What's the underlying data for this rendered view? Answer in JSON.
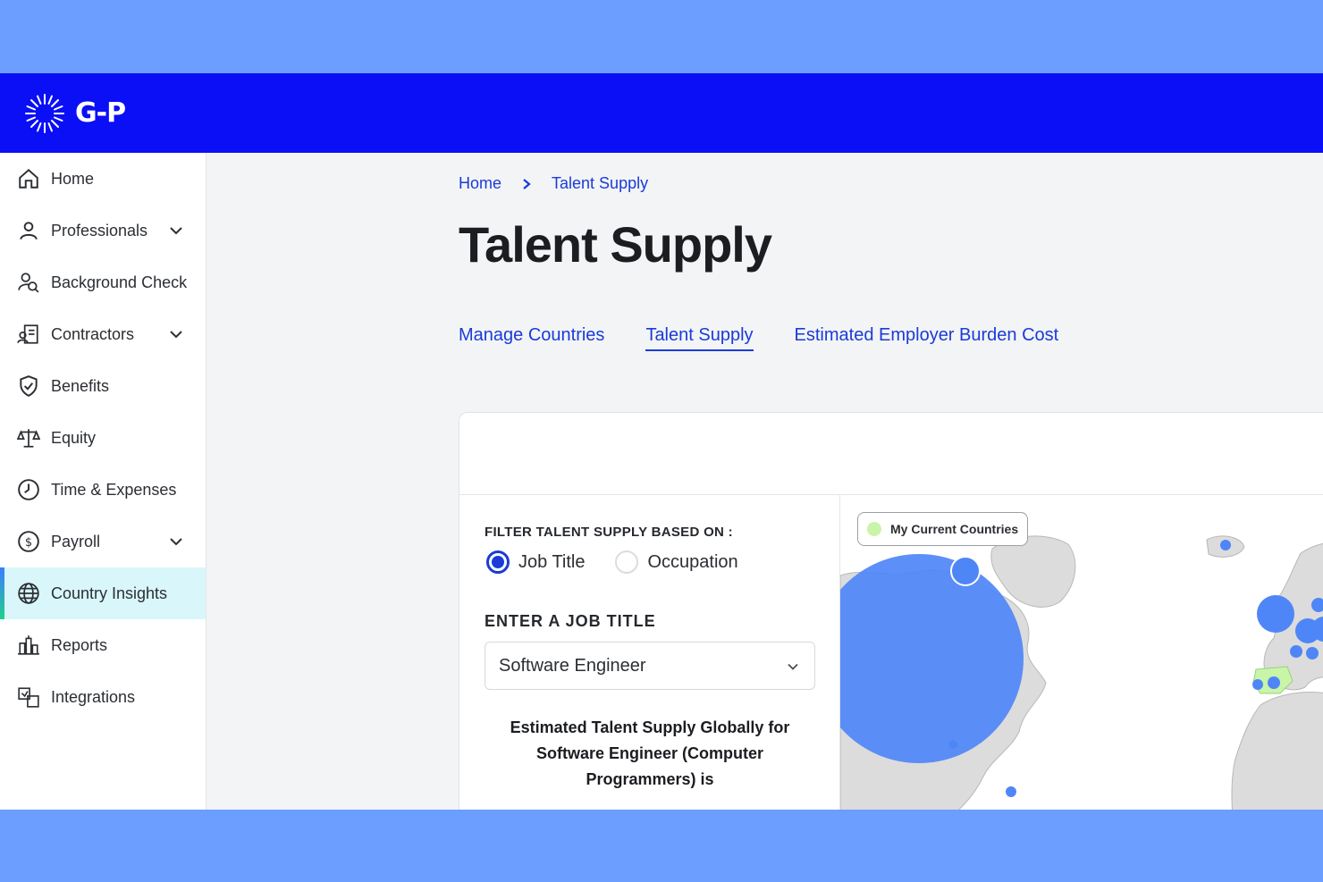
{
  "brand": {
    "logo_text": "G-P"
  },
  "sidebar": {
    "items": [
      {
        "label": "Home",
        "icon": "home-icon"
      },
      {
        "label": "Professionals",
        "icon": "person-icon",
        "expandable": true
      },
      {
        "label": "Background Check",
        "icon": "person-search-icon"
      },
      {
        "label": "Contractors",
        "icon": "contract-icon",
        "expandable": true
      },
      {
        "label": "Benefits",
        "icon": "shield-check-icon"
      },
      {
        "label": "Equity",
        "icon": "scale-icon"
      },
      {
        "label": "Time & Expenses",
        "icon": "clock-icon"
      },
      {
        "label": "Payroll",
        "icon": "dollar-icon",
        "expandable": true
      },
      {
        "label": "Country Insights",
        "icon": "globe-icon",
        "active": true
      },
      {
        "label": "Reports",
        "icon": "buildings-icon"
      },
      {
        "label": "Integrations",
        "icon": "integrations-icon"
      }
    ]
  },
  "breadcrumb": {
    "home": "Home",
    "current": "Talent Supply"
  },
  "page": {
    "title": "Talent Supply"
  },
  "tabs": [
    {
      "label": "Manage Countries"
    },
    {
      "label": "Talent Supply",
      "selected": true
    },
    {
      "label": "Estimated Employer Burden Cost"
    }
  ],
  "filter": {
    "label": "FILTER TALENT SUPPLY BASED ON :",
    "options": [
      {
        "label": "Job Title",
        "checked": true
      },
      {
        "label": "Occupation",
        "checked": false
      }
    ],
    "job_title_label": "ENTER A JOB TITLE",
    "job_title_value": "Software Engineer",
    "estimate_text": "Estimated Talent Supply Globally for Software Engineer (Computer Programmers) is"
  },
  "map": {
    "legend": "My Current Countries",
    "colors": {
      "bubble": "#4f86f7",
      "current_country": "#c8f5a8",
      "land": "#dcdcdc"
    }
  }
}
